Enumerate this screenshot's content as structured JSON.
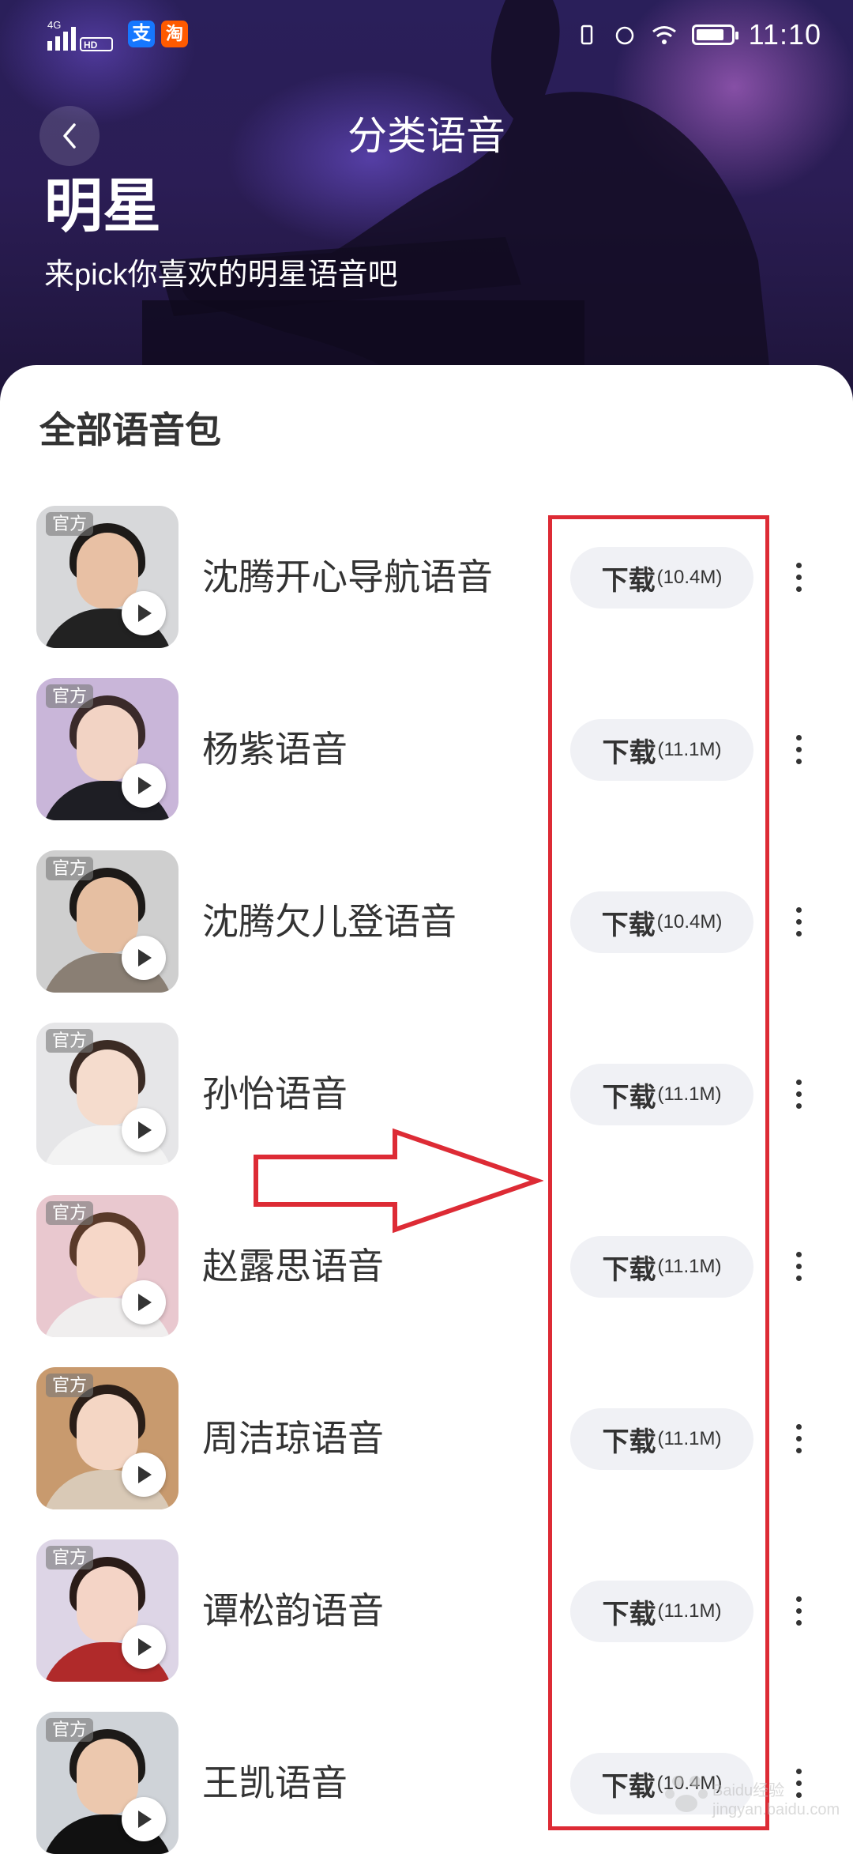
{
  "status_bar": {
    "network": "4G",
    "hd": "HD",
    "app_icon_1": "支",
    "app_icon_2": "淘",
    "time": "11:10"
  },
  "header": {
    "back_icon": "chevron-left-icon",
    "title": "分类语音",
    "category": "明星",
    "subtitle": "来pick你喜欢的明星语音吧"
  },
  "section": {
    "title": "全部语音包"
  },
  "voice_packs": [
    {
      "tag": "官方",
      "name": "沈腾开心导航语音",
      "download_label": "下载",
      "size": "(10.4M)",
      "bg": "#d7d8da",
      "hair": "#1d1a18",
      "skin": "#e8c0a4",
      "cloth": "#222222"
    },
    {
      "tag": "官方",
      "name": "杨紫语音",
      "download_label": "下载",
      "size": "(11.1M)",
      "bg": "#c9b6d9",
      "hair": "#3a2a2a",
      "skin": "#f2d3c4",
      "cloth": "#1e1e24"
    },
    {
      "tag": "官方",
      "name": "沈腾欠儿登语音",
      "download_label": "下载",
      "size": "(10.4M)",
      "bg": "#cfcfcf",
      "hair": "#1d1a18",
      "skin": "#e6bfa2",
      "cloth": "#8a7f74"
    },
    {
      "tag": "官方",
      "name": "孙怡语音",
      "download_label": "下载",
      "size": "(11.1M)",
      "bg": "#e6e6e8",
      "hair": "#3b2b24",
      "skin": "#f5dccd",
      "cloth": "#f3f3f3"
    },
    {
      "tag": "官方",
      "name": "赵露思语音",
      "download_label": "下载",
      "size": "(11.1M)",
      "bg": "#e9c8cf",
      "hair": "#5a3a2a",
      "skin": "#f6d7c8",
      "cloth": "#f0eeee"
    },
    {
      "tag": "官方",
      "name": "周洁琼语音",
      "download_label": "下载",
      "size": "(11.1M)",
      "bg": "#c89a6e",
      "hair": "#2a1e18",
      "skin": "#f4d6c4",
      "cloth": "#d9c9b6"
    },
    {
      "tag": "官方",
      "name": "谭松韵语音",
      "download_label": "下载",
      "size": "(11.1M)",
      "bg": "#ddd5e6",
      "hair": "#2a1c18",
      "skin": "#f4d4c6",
      "cloth": "#b02a2a"
    },
    {
      "tag": "官方",
      "name": "王凯语音",
      "download_label": "下载",
      "size": "(10.4M)",
      "bg": "#cfd3d8",
      "hair": "#1d1a18",
      "skin": "#ecc8ae",
      "cloth": "#111111"
    }
  ],
  "watermark": "Baidu经验 jingyan.baidu.com",
  "colors": {
    "accent_annotation": "#dd2b35",
    "download_bg": "#f0f1f5",
    "text_primary": "#333333"
  }
}
